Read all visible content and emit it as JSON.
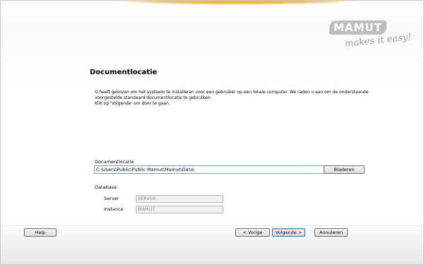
{
  "logo": {
    "brand": "MAMUT",
    "tagline": "makes it easy!"
  },
  "page": {
    "title": "Documentlocatie",
    "description": [
      "U heeft gekozen om het systeem te installeren voor een gebruiker op een lokale computer. We raden u aan om de onderstaande",
      "voorgestelde standaard documentlocatie te gebruiken.",
      "Klik op 'Volgende' om door te gaan."
    ]
  },
  "document_location": {
    "label": "Documentlocatie",
    "value": "C:\\Users\\Public\\Public Mamut\\Mamut\\Data\\",
    "browse_label": "Bladeren"
  },
  "database": {
    "label": "Database:",
    "server_label": "Server",
    "server_value": "SERVER",
    "instance_label": "Instance",
    "instance_value": "MAMUT"
  },
  "buttons": {
    "help": "Help",
    "previous": "< Vorige",
    "next": "Volgende >",
    "cancel": "Annuleren"
  },
  "colors": {
    "accent_swoosh": "#f5b400",
    "input_border": "#7a9cc6",
    "default_button_border": "#3c7fb1"
  }
}
